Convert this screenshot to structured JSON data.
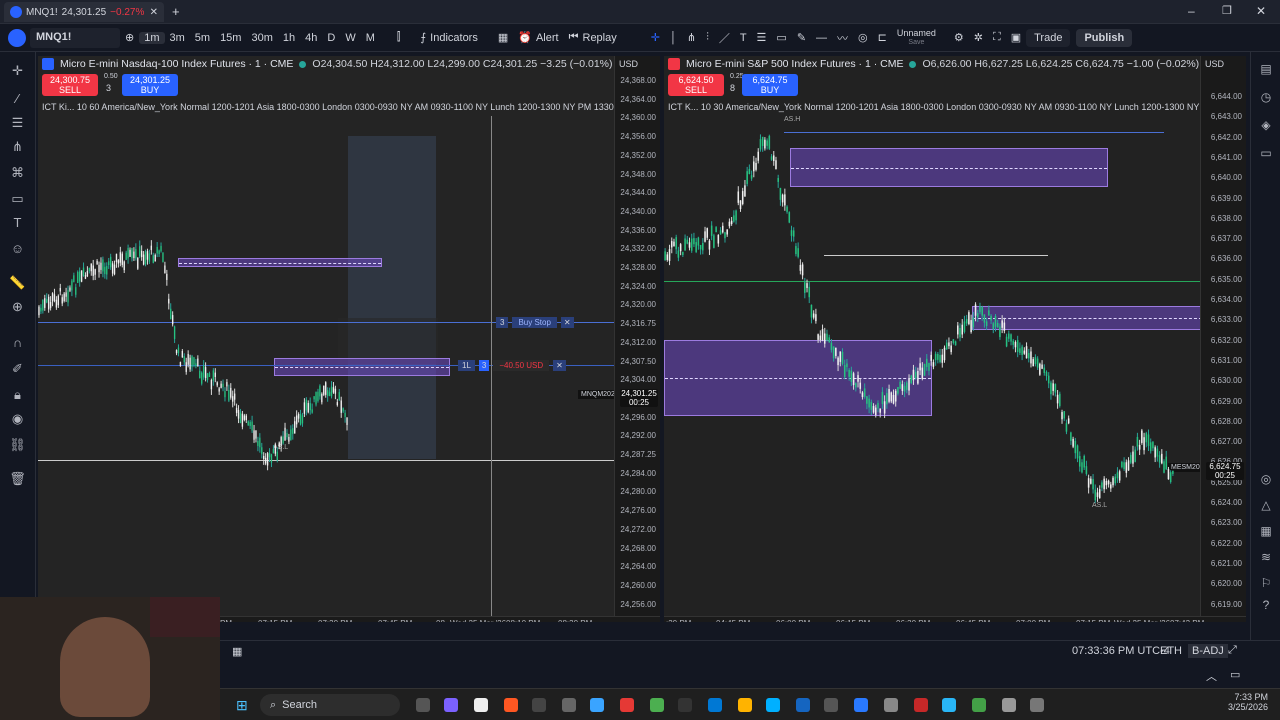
{
  "tab": {
    "symbol": "MNQ1!",
    "price": "24,301.25",
    "change": "−0.27%",
    "close": "✕",
    "add": "+"
  },
  "toolbar": {
    "symbol": "MNQ1!",
    "intervals": [
      "1m",
      "3m",
      "5m",
      "15m",
      "30m",
      "1h",
      "4h",
      "D",
      "W",
      "M"
    ],
    "indicators": "Indicators",
    "alert": "Alert",
    "replay": "Replay",
    "layout_name": "Unnamed",
    "layout_sub": "Save",
    "trade": "Trade",
    "publish": "Publish"
  },
  "left": {
    "title": "Micro E-mini Nasdaq-100 Index Futures · 1 · CME",
    "ohlc": "O24,304.50 H24,312.00 L24,299.00 C24,301.25 −3.25 (−0.01%)",
    "currency": "USD",
    "sell_price": "24,300.75",
    "sell_label": "SELL",
    "qty": "3",
    "buy_price": "24,301.25",
    "buy_label": "BUY",
    "spread": "0.50",
    "session": "ICT Ki... 10 60 America/New_York Normal 1200-1201 Asia 1800-0300 London 0300-0930 NY AM 0930-1100 NY Lunch 1200-1300 NY PM 1330-1600 70 4",
    "order_buy_stop": {
      "qty": "3",
      "label": "Buy Stop"
    },
    "order_position": {
      "side": "1L",
      "qty": "3",
      "pnl": "−40.50 USD"
    },
    "symbol_tag": "MNQM2026",
    "tag_price": "24,301.25",
    "tag_time": "00:25",
    "price_labels": [
      "24,368.00",
      "24,364.00",
      "24,360.00",
      "24,356.00",
      "24,352.00",
      "24,348.00",
      "24,344.00",
      "24,340.00",
      "24,336.00",
      "24,332.00",
      "24,328.00",
      "24,324.00",
      "24,320.00",
      "24,316.75",
      "24,312.00",
      "24,307.50",
      "24,304.00",
      "24,300.00",
      "24,296.00",
      "24,292.00",
      "24,287.25",
      "24,284.00",
      "24,280.00",
      "24,276.00",
      "24,272.00",
      "24,268.00",
      "24,264.00",
      "24,260.00",
      "24,256.00"
    ],
    "time_labels": [
      "PM",
      "07:15 PM",
      "07:30 PM",
      "07:45 PM",
      "08",
      "Wed 25 Mar '26",
      "08:10 PM",
      "08:30 PM"
    ],
    "note": "AS.L"
  },
  "right": {
    "title": "Micro E-mini S&P 500 Index Futures · 1 · CME",
    "ohlc": "O6,626.00 H6,627.25 L6,624.25 C6,624.75 −1.00 (−0.02%)",
    "currency": "USD",
    "sell_price": "6,624.50",
    "sell_label": "SELL",
    "qty": "8",
    "buy_price": "6,624.75",
    "buy_label": "BUY",
    "spread": "0.25",
    "session": "ICT K... 10 30 America/New_York Normal 1200-1201 Asia 1800-0300 London 0300-0930 NY AM 0930-1100 NY Lunch 1200-1300 NY PM 1330-",
    "symbol_tag": "MESM2026",
    "tag_price": "6,624.75",
    "tag_time": "00:25",
    "price_labels": [
      "6,644.00",
      "6,643.00",
      "6,642.00",
      "6,641.00",
      "6,640.00",
      "6,639.00",
      "6,638.00",
      "6,637.00",
      "6,636.00",
      "6,635.00",
      "6,634.00",
      "6,633.00",
      "6,632.00",
      "6,631.00",
      "6,630.00",
      "6,629.00",
      "6,628.00",
      "6,627.00",
      "6,626.00",
      "6,625.00",
      "6,624.00",
      "6,623.00",
      "6,622.00",
      "6,621.00",
      "6,620.00",
      "6,619.00",
      "6,618.00"
    ],
    "time_labels": [
      ":30 PM",
      "04:45 PM",
      "06:00 PM",
      "06:15 PM",
      "06:30 PM",
      "06:45 PM",
      "07:00 PM",
      "07:15 PM",
      "Wed 25 Mar '26",
      "07:43 PM"
    ],
    "note_top": "AS.H",
    "note_bottom": "AS.L"
  },
  "bottom": {
    "clock": "07:33:36 PM UTC-4",
    "session": "ETH",
    "adj": "B-ADJ"
  },
  "taskbar": {
    "search": "Search",
    "time": "7:33 PM",
    "date": "3/25/2026"
  }
}
